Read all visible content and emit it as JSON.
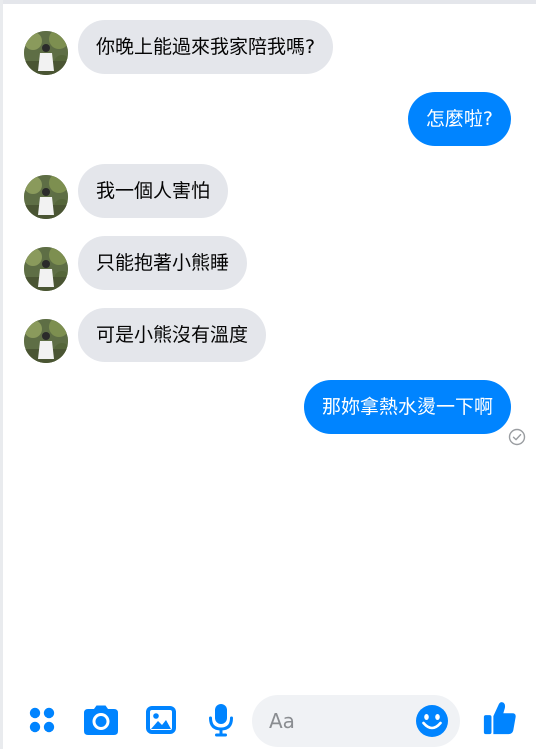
{
  "messages": [
    {
      "sender": "other",
      "text": "你晚上能過來我家陪我嗎?"
    },
    {
      "sender": "me",
      "text": "怎麼啦?"
    },
    {
      "sender": "other",
      "text": "我一個人害怕"
    },
    {
      "sender": "other",
      "text": "只能抱著小熊睡"
    },
    {
      "sender": "other",
      "text": "可是小熊沒有溫度"
    },
    {
      "sender": "me",
      "text": "那妳拿熱水燙一下啊"
    }
  ],
  "composer": {
    "placeholder": "Aa",
    "tools": [
      "more-apps-icon",
      "camera-icon",
      "image-icon",
      "microphone-icon"
    ],
    "emoji_icon": "smiley-icon",
    "send_icon": "thumbs-up-icon"
  },
  "colors": {
    "accent": "#0084ff",
    "incoming_bubble": "#e4e6eb",
    "input_bg": "#f0f2f5"
  }
}
